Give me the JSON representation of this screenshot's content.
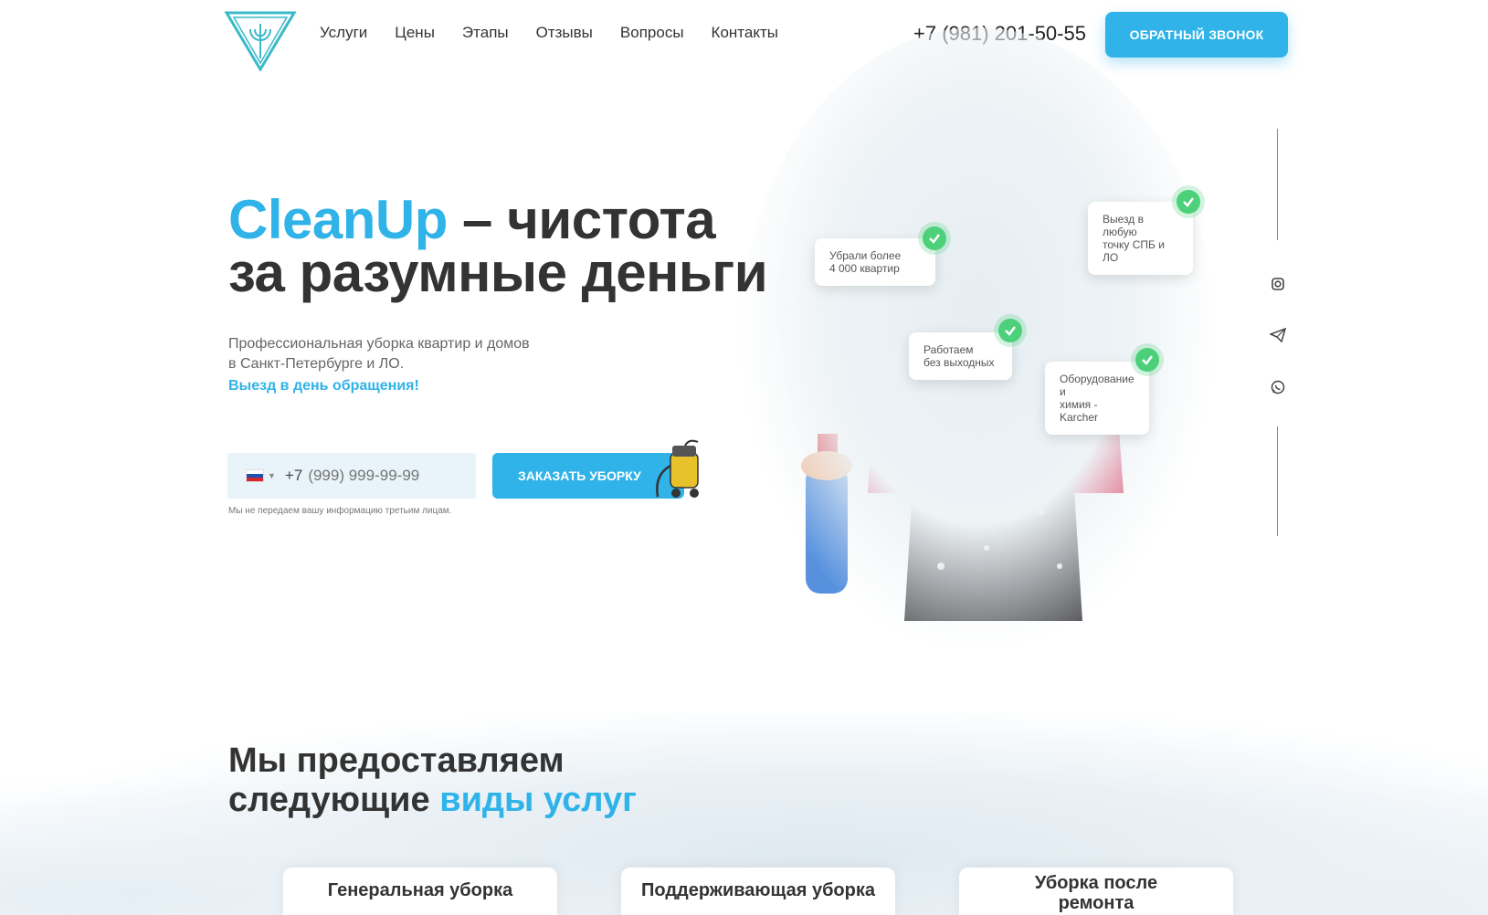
{
  "header": {
    "nav": [
      "Услуги",
      "Цены",
      "Этапы",
      "Отзывы",
      "Вопросы",
      "Контакты"
    ],
    "phone": "+7 (981) 201-50-55",
    "callback_label": "ОБРАТНЫЙ ЗВОНОК"
  },
  "hero": {
    "title_brand": "CleanUp",
    "title_rest_1": " – чистота",
    "title_rest_2": "за разумные деньги",
    "subtitle_1": "Профессиональная уборка квартир и домов",
    "subtitle_2": "в Санкт-Петербурге и ЛО.",
    "note": "Выезд в день обращения!",
    "phone_prefix": "+7",
    "phone_placeholder": "(999) 999-99-99",
    "order_label": "ЗАКАЗАТЬ УБОРКУ",
    "disclaimer": "Мы не передаем вашу информацию третьим лицам."
  },
  "badges": [
    {
      "line1": "Убрали более",
      "line2": "4 000 квартир"
    },
    {
      "line1": "Выезд в любую",
      "line2": "точку СПБ и ЛО"
    },
    {
      "line1": "Работаем",
      "line2": "без выходных"
    },
    {
      "line1": "Оборудование и",
      "line2": "химия - Karcher"
    }
  ],
  "social": [
    "instagram-icon",
    "telegram-icon",
    "whatsapp-icon"
  ],
  "services": {
    "title_1": "Мы предоставляем",
    "title_2_plain": "следующие ",
    "title_2_accent": "виды услуг",
    "cards": [
      {
        "line1": "Генеральная уборка",
        "line2": ""
      },
      {
        "line1": "Поддерживающая уборка",
        "line2": ""
      },
      {
        "line1": "Уборка после",
        "line2": "ремонта"
      }
    ]
  },
  "colors": {
    "accent": "#2fb3e8",
    "text": "#333333",
    "check": "#4cd07a"
  }
}
